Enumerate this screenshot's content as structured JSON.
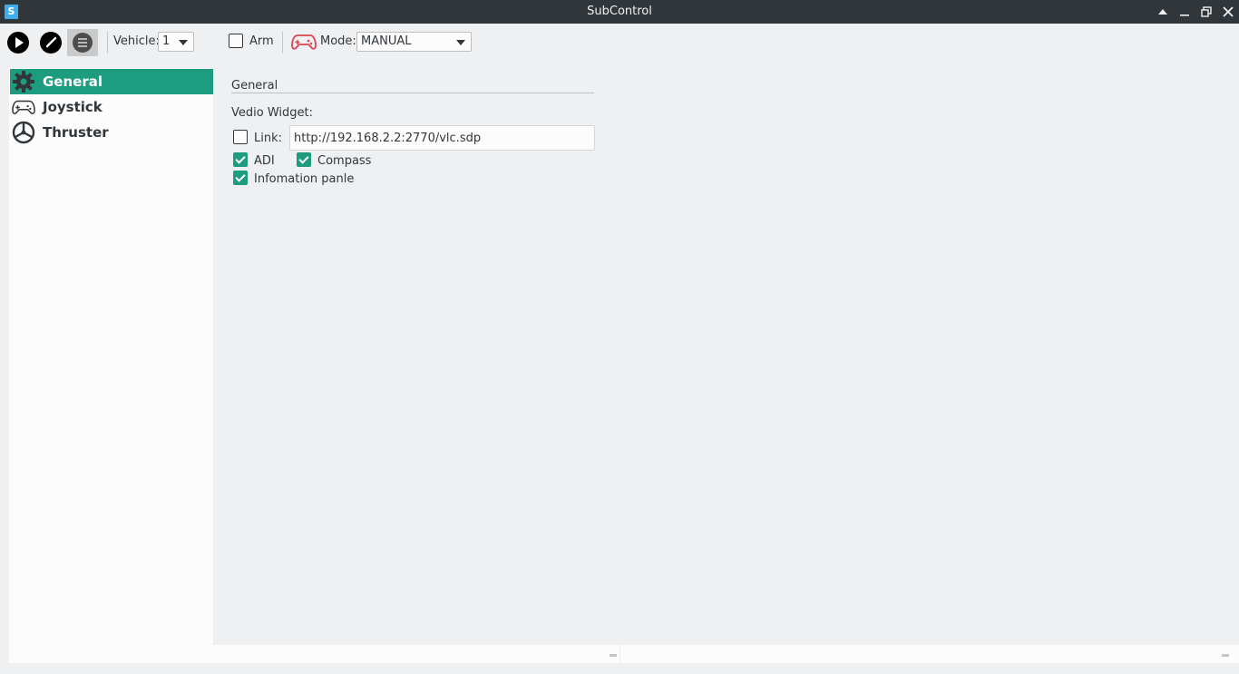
{
  "window": {
    "app_icon_letter": "S",
    "title": "SubControl"
  },
  "toolbar": {
    "vehicle_label": "Vehicle:",
    "vehicle_value": "1",
    "arm_label": "Arm",
    "arm_checked": false,
    "mode_label": "Mode:",
    "mode_value": "MANUAL",
    "gamepad_color": "#da4453"
  },
  "sidebar": {
    "items": [
      {
        "label": "General",
        "icon": "gear-icon",
        "selected": true
      },
      {
        "label": "Joystick",
        "icon": "gamepad-icon",
        "selected": false
      },
      {
        "label": "Thruster",
        "icon": "thruster-icon",
        "selected": false
      }
    ]
  },
  "general": {
    "group_title": "General",
    "video_widget_label": "Vedio Widget:",
    "link_label": "Link:",
    "link_checked": false,
    "link_value": "http://192.168.2.2:2770/vlc.sdp",
    "adi_label": "ADI",
    "adi_checked": true,
    "compass_label": "Compass",
    "compass_checked": true,
    "info_panel_label": "Infomation panle",
    "info_panel_checked": true
  },
  "colors": {
    "accent": "#1d9c80",
    "titlebar": "#31363b",
    "background": "#eff0f1"
  }
}
